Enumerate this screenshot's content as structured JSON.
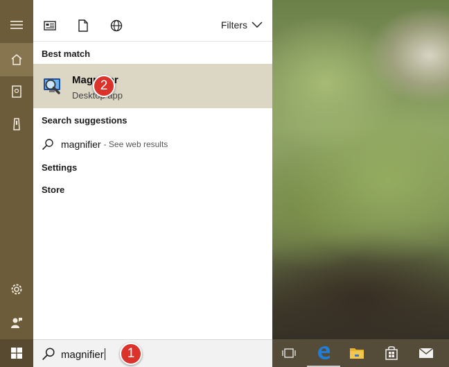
{
  "toolbar": {
    "icons": [
      "apps-icon",
      "documents-icon",
      "web-icon"
    ],
    "filters_label": "Filters"
  },
  "sections": {
    "best_match": "Best match",
    "search_suggestions": "Search suggestions",
    "settings": "Settings",
    "store": "Store"
  },
  "best_match_item": {
    "title": "Magnifier",
    "subtitle": "Desktop app",
    "icon": "magnifier-app-icon"
  },
  "suggestion": {
    "query": "magnifier",
    "hint": "- See web results"
  },
  "search": {
    "value": "magnifier"
  },
  "annotations": {
    "step1": "1",
    "step2": "2"
  },
  "rail": [
    "hamburger-icon",
    "home-icon",
    "notebook-icon",
    "device-icon",
    "settings-icon",
    "feedback-icon"
  ],
  "taskbar": [
    "task-view-icon",
    "edge-icon",
    "file-explorer-icon",
    "store-icon",
    "mail-icon"
  ],
  "colors": {
    "rail": "#6d5c3a",
    "highlight": "#dcd6c5",
    "badge": "#d9332b",
    "edge": "#1f7fd8",
    "folder": "#e8b42f"
  }
}
